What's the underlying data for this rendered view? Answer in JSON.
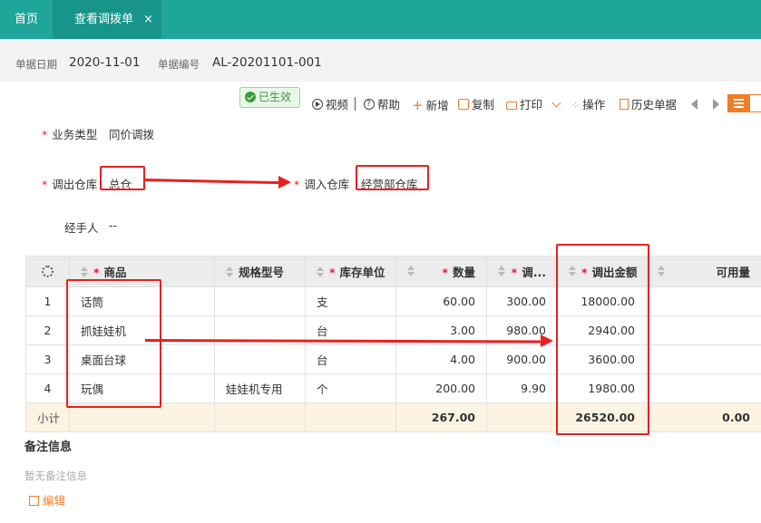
{
  "tabs": {
    "home": "首页",
    "active": "查看调拨单",
    "close": "×"
  },
  "info": {
    "date_label": "单据日期",
    "date_value": "2020-11-01",
    "number_label": "单据编号",
    "number_value": "AL-20201101-001"
  },
  "status": "已生效",
  "toolbar": {
    "video": "视频",
    "help": "帮助",
    "add": "新增",
    "copy": "复制",
    "print": "打印",
    "operate": "操作",
    "history": "历史单据"
  },
  "form": {
    "business_type_label": "业务类型",
    "business_type_value": "同价调拨",
    "out_wh_label": "调出仓库",
    "out_wh_value": "总仓",
    "in_wh_label": "调入仓库",
    "in_wh_value": "经营部仓库",
    "handler_label": "经手人",
    "handler_value": "--"
  },
  "table": {
    "headers": {
      "product": "商品",
      "spec": "规格型号",
      "unit": "库存单位",
      "qty": "数量",
      "price": "调...",
      "amount": "调出金额",
      "available": "可用量"
    },
    "rows": [
      {
        "idx": "1",
        "product": "话筒",
        "spec": "",
        "unit": "支",
        "qty": "60.00",
        "price": "300.00",
        "amount": "18000.00",
        "available": ""
      },
      {
        "idx": "2",
        "product": "抓娃娃机",
        "spec": "",
        "unit": "台",
        "qty": "3.00",
        "price": "980.00",
        "amount": "2940.00",
        "available": ""
      },
      {
        "idx": "3",
        "product": "桌面台球",
        "spec": "",
        "unit": "台",
        "qty": "4.00",
        "price": "900.00",
        "amount": "3600.00",
        "available": ""
      },
      {
        "idx": "4",
        "product": "玩偶",
        "spec": "娃娃机专用",
        "unit": "个",
        "qty": "200.00",
        "price": "9.90",
        "amount": "1980.00",
        "available": ""
      }
    ],
    "subtotal": {
      "label": "小计",
      "qty": "267.00",
      "amount": "26520.00",
      "available": "0.00"
    }
  },
  "remarks": {
    "title": "备注信息",
    "empty": "暂无备注信息",
    "edit": "编辑"
  },
  "colors": {
    "brand": "#1ea69a",
    "accent": "#f07d27",
    "annotation": "#e82020"
  }
}
